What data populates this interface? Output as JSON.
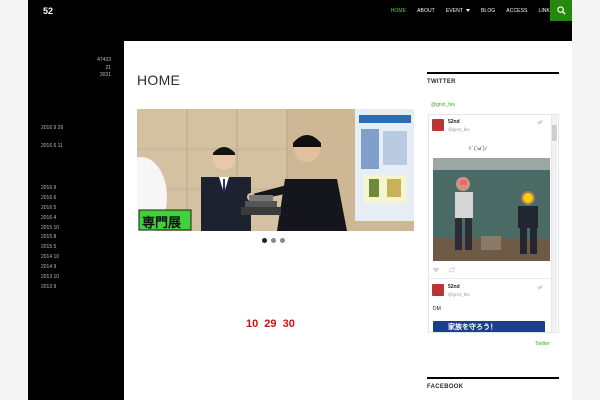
{
  "header": {
    "site_title": "52",
    "nav": [
      {
        "label": "HOME",
        "active": true
      },
      {
        "label": "ABOUT"
      },
      {
        "label": "EVENT",
        "has_dropdown": true
      },
      {
        "label": "BLOG"
      },
      {
        "label": "ACCESS"
      },
      {
        "label": "LINK"
      }
    ],
    "search_icon": "search-icon"
  },
  "sidebar": {
    "stats": [
      {
        "label": "",
        "value": "47433"
      },
      {
        "label": "",
        "value": "21"
      },
      {
        "label": "",
        "value": "3031"
      }
    ],
    "dates": [
      "2016 9 26",
      "2016 6 11"
    ],
    "archives": [
      "2016 9",
      "2016 6",
      "2016 5",
      "2016 4",
      "2015 10",
      "2015 8",
      "2015 5",
      "2014 10",
      "2014 9",
      "2013 10",
      "2013 9"
    ]
  },
  "main": {
    "title": "HOME",
    "slider_caption": "専門展",
    "slider_dots": 3,
    "countdown": "10 29 30"
  },
  "twitter": {
    "heading": "TWITTER",
    "handle": "@gnct_fes",
    "tweets": [
      {
        "name": "52nd",
        "user": "@gnct_fes",
        "text": "ﾄﾞ(`ω´)ﾉ"
      },
      {
        "name": "52nd",
        "user": "@gnct_fes",
        "text": "DM"
      }
    ],
    "banner_text": "家族を守ろう！",
    "footer_link": "Twitter"
  },
  "facebook": {
    "heading": "FACEBOOK"
  },
  "colors": {
    "accent": "#24890d",
    "accent_text": "#55d737",
    "countdown": "#cc1111"
  }
}
